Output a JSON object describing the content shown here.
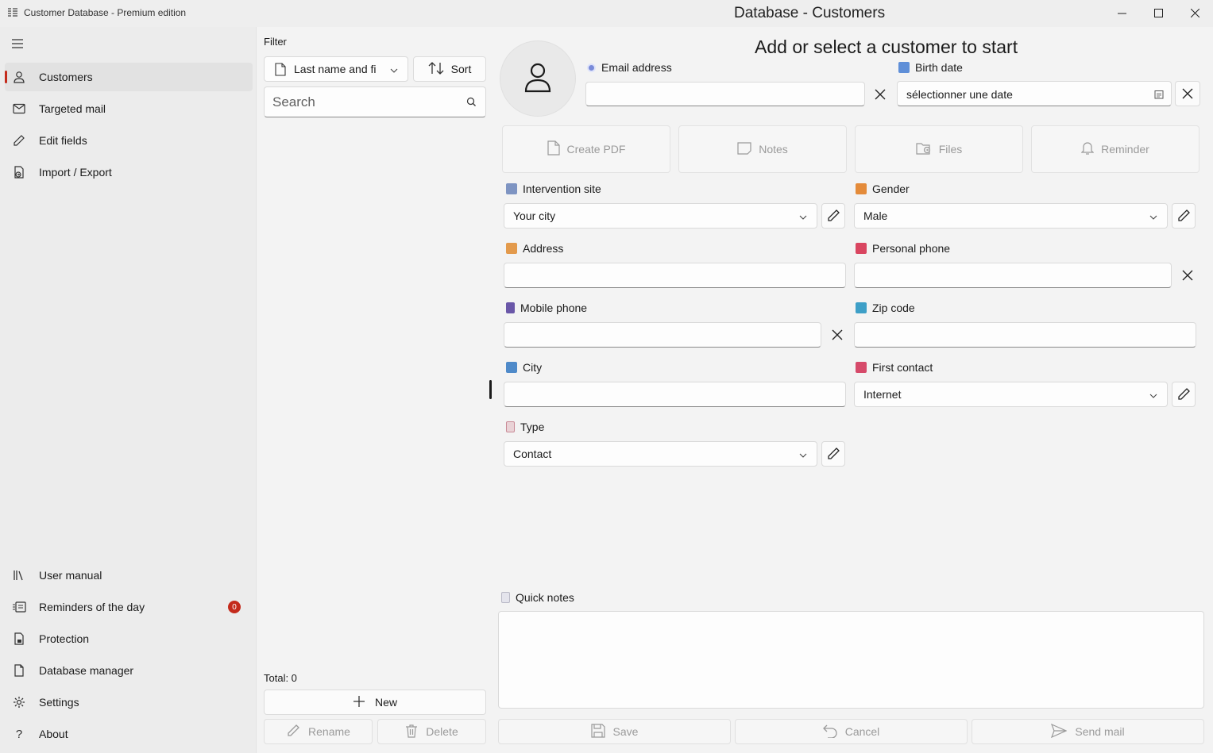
{
  "app": {
    "app_title": "Customer Database - Premium edition",
    "window_title": "Database - Customers"
  },
  "sidebar": {
    "top_items": [
      {
        "label": "Customers",
        "icon": "person-icon",
        "active": true
      },
      {
        "label": "Targeted mail",
        "icon": "mail-icon"
      },
      {
        "label": "Edit fields",
        "icon": "pencil-icon"
      },
      {
        "label": "Import / Export",
        "icon": "import-export-icon"
      }
    ],
    "bottom_items": [
      {
        "label": "User manual",
        "icon": "library-icon"
      },
      {
        "label": "Reminders of the day",
        "icon": "reminders-icon",
        "badge": "0"
      },
      {
        "label": "Protection",
        "icon": "shield-icon"
      },
      {
        "label": "Database manager",
        "icon": "document-icon"
      },
      {
        "label": "Settings",
        "icon": "gear-icon"
      },
      {
        "label": "About",
        "icon": "question-icon"
      }
    ]
  },
  "listpane": {
    "filter_label": "Filter",
    "filter_value": "Last name and fi",
    "sort_label": "Sort",
    "search_placeholder": "Search",
    "total": "Total: 0",
    "new_label": "New",
    "rename_label": "Rename",
    "delete_label": "Delete"
  },
  "main": {
    "heading": "Add or select a customer to start",
    "email_label": "Email address",
    "email_value": "",
    "birth_label": "Birth date",
    "birth_placeholder": "sélectionner une date",
    "actions": [
      {
        "label": "Create PDF",
        "icon": "document-icon"
      },
      {
        "label": "Notes",
        "icon": "notes-icon"
      },
      {
        "label": "Files",
        "icon": "folder-icon"
      },
      {
        "label": "Reminder",
        "icon": "bell-icon"
      }
    ],
    "fields": {
      "intervention_site": {
        "label": "Intervention site",
        "value": "Your city"
      },
      "gender": {
        "label": "Gender",
        "value": "Male"
      },
      "address": {
        "label": "Address",
        "value": ""
      },
      "personal_phone": {
        "label": "Personal phone",
        "value": ""
      },
      "mobile_phone": {
        "label": "Mobile phone",
        "value": ""
      },
      "zip_code": {
        "label": "Zip code",
        "value": ""
      },
      "city": {
        "label": "City",
        "value": ""
      },
      "first_contact": {
        "label": "First contact",
        "value": "Internet"
      },
      "type": {
        "label": "Type",
        "value": "Contact"
      }
    },
    "quick_notes_label": "Quick notes",
    "quick_notes_value": "",
    "save_label": "Save",
    "cancel_label": "Cancel",
    "send_mail_label": "Send mail"
  },
  "colors": {
    "accent": "#c42b1c",
    "background": "#f3f3f3"
  }
}
